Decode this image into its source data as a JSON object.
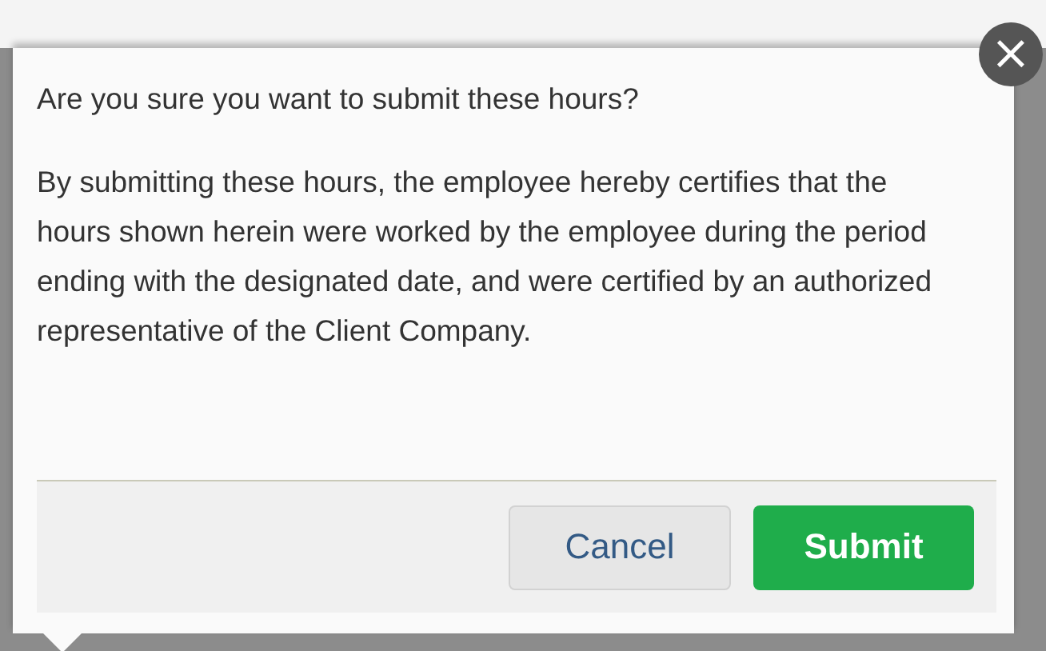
{
  "dialog": {
    "question": "Are you sure you want to submit these hours?",
    "statement": "By submitting these hours, the employee hereby certifies that the hours shown herein were worked by the employee during the period ending with the designated date, and were certified by an authorized representative of the Client Company.",
    "close_button": "×",
    "buttons": [
      {
        "label": "Cancel",
        "kind": "secondary"
      },
      {
        "label": "Submit",
        "kind": "primary"
      }
    ]
  }
}
